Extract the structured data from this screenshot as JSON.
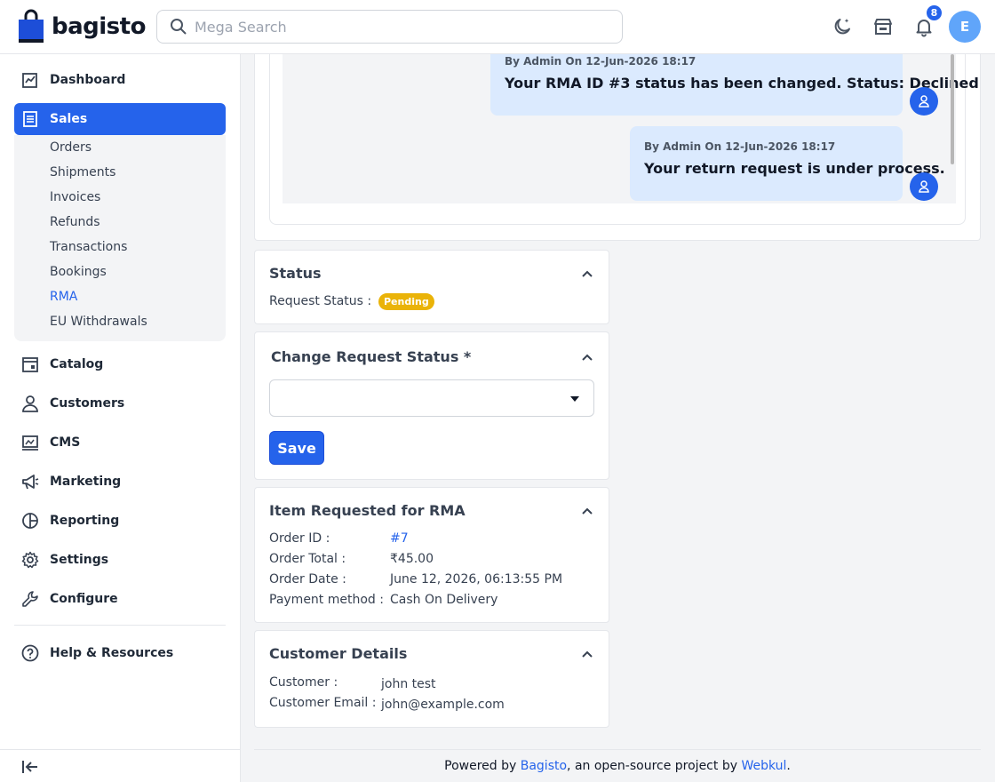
{
  "header": {
    "logo_text": "bagisto",
    "search_placeholder": "Mega Search",
    "notification_count": "8",
    "avatar_initial": "E"
  },
  "sidebar": {
    "items": [
      {
        "label": "Dashboard",
        "icon": "dashboard-icon"
      },
      {
        "label": "Sales",
        "icon": "sales-icon"
      },
      {
        "label": "Catalog",
        "icon": "catalog-icon"
      },
      {
        "label": "Customers",
        "icon": "customers-icon"
      },
      {
        "label": "CMS",
        "icon": "cms-icon"
      },
      {
        "label": "Marketing",
        "icon": "marketing-icon"
      },
      {
        "label": "Reporting",
        "icon": "reporting-icon"
      },
      {
        "label": "Settings",
        "icon": "settings-icon"
      },
      {
        "label": "Configure",
        "icon": "configure-icon"
      }
    ],
    "sales_submenu": [
      "Orders",
      "Shipments",
      "Invoices",
      "Refunds",
      "Transactions",
      "Bookings",
      "RMA",
      "EU Withdrawals"
    ],
    "active_submenu": "RMA",
    "help_label": "Help & Resources"
  },
  "conversation": {
    "messages": [
      {
        "meta": "By Admin On 12-Jun-2026 18:17",
        "text": "Your RMA ID #3 status has been changed. Status: Declined"
      },
      {
        "meta": "By Admin On 12-Jun-2026 18:17",
        "text": "Your return request is under process."
      }
    ]
  },
  "status_card": {
    "title": "Status",
    "request_status_label": "Request Status :",
    "request_status_value": "Pending",
    "badge_color": "#eab308"
  },
  "change_status_card": {
    "title": "Change Request Status *",
    "select_value": "",
    "save_label": "Save"
  },
  "item_card": {
    "title": "Item Requested for RMA",
    "rows": [
      {
        "label": "Order ID :",
        "value": "#7"
      },
      {
        "label": "Order Total :",
        "value": "₹45.00"
      },
      {
        "label": "Order Date :",
        "value": "June 12, 2026, 06:13:55 PM"
      },
      {
        "label": "Payment method :",
        "value": "Cash On Delivery"
      }
    ]
  },
  "customer_card": {
    "title": "Customer Details",
    "rows": [
      {
        "label": "Customer :",
        "value": "john test"
      },
      {
        "label": "Customer Email :",
        "value": "john@example.com"
      }
    ]
  },
  "footer": {
    "prefix": "Powered by ",
    "brand": "Bagisto",
    "middle": ", an open-source project by ",
    "company": "Webkul",
    "suffix": "."
  },
  "colors": {
    "accent": "#2563eb",
    "message_bg": "#dbeafe"
  }
}
